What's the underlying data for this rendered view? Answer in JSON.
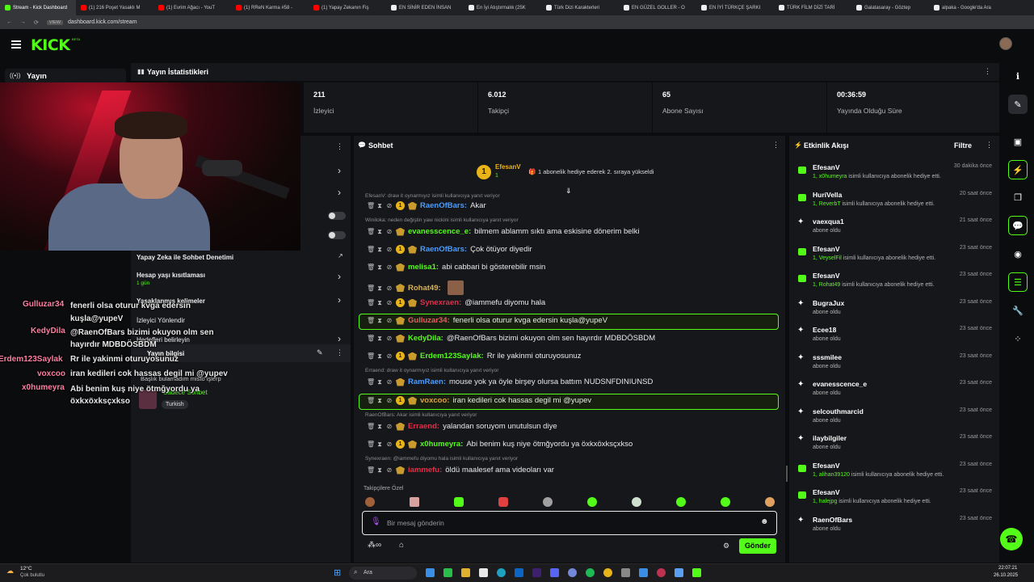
{
  "browser": {
    "tabs": [
      {
        "label": "Stream - Kick Dashboard",
        "active": true
      },
      {
        "label": "(1) 216 Poşet Yasaklı M"
      },
      {
        "label": "(1) Evrim Ağacı - YouT"
      },
      {
        "label": "(1) RReN Karma #58 -"
      },
      {
        "label": "(1) Yapay Zekanın Fiş"
      },
      {
        "label": "EN SİNİR EDEN İNSAN"
      },
      {
        "label": "En İyi Atıştırmalık (25K"
      },
      {
        "label": "Türk Dizi Karakterleri"
      },
      {
        "label": "EN GÜZEL GOLLER - O"
      },
      {
        "label": "EN İYİ TÜRKÇE ŞARKI"
      },
      {
        "label": "TÜRK FİLM DİZİ TARİ"
      },
      {
        "label": "Galatasaray - Göztep"
      },
      {
        "label": "alpaka - Google'da Ara"
      }
    ],
    "url": "dashboard.kick.com/stream",
    "site_badge": "VIEW"
  },
  "header": {
    "logo": "KICK",
    "logo_badge": "BETA"
  },
  "left_nav": {
    "section": "Yayın"
  },
  "stats": {
    "title": "Yayın İstatistikleri",
    "items": [
      {
        "value": "211",
        "label": "İzleyici"
      },
      {
        "value": "6.012",
        "label": "Takipçi"
      },
      {
        "value": "65",
        "label": "Abone Sayısı"
      },
      {
        "value": "00:36:59",
        "label": "Yayında Olduğu Süre"
      }
    ]
  },
  "settings_panel": {
    "ai_moderation": "Yapay Zeka ile Sohbet Denetimi",
    "account_age": "Hesap yaşı kısıtlaması",
    "account_age_value": "1 gün",
    "banned_words": "Yasaklanmış kelimeler",
    "viewer_redirect": "İzleyici Yönlendir",
    "target_label": "Hedefleri belirleyin",
    "stream_info": "Yayın bilgisi",
    "stream_title_partial": "Başlık bulamadım misto işlerp",
    "mode": "Sadece Sohbet",
    "language": "Turkish"
  },
  "overlay_chat": [
    {
      "user": "Gulluzar34",
      "text": "fenerli olsa oturur kvga edersin kuşla@yupeV"
    },
    {
      "user": "KedyDila",
      "text": "@RaenOfBars bizimi okuyon olm sen hayırdır MDBDÖSBDM"
    },
    {
      "user": "Erdem123Saylak",
      "text": "Rr ile yakinmi oturuyosunuz"
    },
    {
      "user": "voxcoo",
      "text": "iran kedileri cok hassas degil mi @yupev"
    },
    {
      "user": "x0humeyra",
      "text": "Abi benim kuş niye ötmğyordu ya öxkxöxksçxkso"
    }
  ],
  "chat": {
    "title": "Sohbet",
    "pinned_user": "EfesanV",
    "pinned_count": "1",
    "pinned_text": "1 abonelik hediye ederek 2. sıraya yükseldi",
    "reply_top": "EfesanV: draw it oynarmıyız isimli kullanıcıya yanıt veriyor",
    "messages": [
      {
        "user": "RaenOfBars",
        "color": "#4a9cff",
        "text": "Akar"
      },
      {
        "reply": "Winiloka: neden değiştin yaw nickini isimli kullanıcıya yanıt veriyor"
      },
      {
        "user": "evanesscence_e",
        "color": "#53fc18",
        "text": "bilmem ablamm sıktı ama eskisine dönerim belki"
      },
      {
        "user": "RaenOfBars",
        "color": "#4a9cff",
        "text": "Çok ötüyor diyedir"
      },
      {
        "user": "melisa1",
        "color": "#53fc18",
        "text": "abi cabbari bi gösterebilir msin"
      },
      {
        "user": "Rohat49",
        "color": "#d6b35a",
        "text": ""
      },
      {
        "user": "Synexraen",
        "color": "#e0304a",
        "text": "@iammefu diyomu hala"
      },
      {
        "user": "Gulluzar34",
        "color": "#e06060",
        "text": "fenerli olsa oturur kvga edersin kuşla@yupeV"
      },
      {
        "user": "KedyDila",
        "color": "#53fc18",
        "text": "@RaenOfBars bizimi okuyon olm sen hayırdır MDBDÖSBDM"
      },
      {
        "user": "Erdem123Saylak",
        "color": "#53fc18",
        "text": "Rr ile yakinmi oturuyosunuz"
      },
      {
        "reply": "Erraend: draw it oynarmıyız isimli kullanıcıya yanıt veriyor"
      },
      {
        "user": "RamRaen",
        "color": "#4a9cff",
        "text": "mouse yok ya öyle birşey olursa battım NUDSNFDINIUNSD"
      },
      {
        "user": "voxcoo",
        "color": "#e0a040",
        "text": "iran kedileri cok hassas degil mi @yupev"
      },
      {
        "reply": "RaenOfBars: Akar isimli kullanıcıya yanıt veriyor"
      },
      {
        "user": "Erraend",
        "color": "#e0304a",
        "text": "yalandan soruyom unutulsun diye"
      },
      {
        "user": "x0humeyra",
        "color": "#53fc18",
        "text": "Abi benim kuş niye ötmğyordu ya öxkxöxksçxkso"
      },
      {
        "reply": "Synexraen: @iammefu diyomu hala isimli kullanıcıya yanıt veriyor"
      },
      {
        "user": "iammefu",
        "color": "#e0304a",
        "text": "öldü maalesef ama videoları var"
      }
    ],
    "emote_section": "Takipçilere Özel",
    "input_placeholder": "Bir mesaj gönderin",
    "send": "Gönder"
  },
  "activity": {
    "title": "Etkinlik Akışı",
    "filter": "Filtre",
    "items": [
      {
        "name": "EfesanV",
        "time": "30 dakika önce",
        "count": "1,",
        "target": "x0humeyra",
        "text": "isimli kullanıcıya abonelik hediye etti.",
        "type": "gift"
      },
      {
        "name": "HuriVella",
        "time": "20 saat önce",
        "count": "1,",
        "target": "ReverbT",
        "text": "isimli kullanıcıya abonelik hediye etti.",
        "type": "gift"
      },
      {
        "name": "vaexqua1",
        "time": "21 saat önce",
        "text": "abone oldu",
        "type": "sub"
      },
      {
        "name": "EfesanV",
        "time": "23 saat önce",
        "count": "1,",
        "target": "VeyselFil",
        "text": "isimli kullanıcıya abonelik hediye etti.",
        "type": "gift"
      },
      {
        "name": "EfesanV",
        "time": "23 saat önce",
        "count": "1,",
        "target": "Rohat49",
        "text": "isimli kullanıcıya abonelik hediye etti.",
        "type": "gift"
      },
      {
        "name": "BugraJux",
        "time": "23 saat önce",
        "text": "abone oldu",
        "type": "sub"
      },
      {
        "name": "Ecee18",
        "time": "23 saat önce",
        "text": "abone oldu",
        "type": "sub"
      },
      {
        "name": "sssmilee",
        "time": "23 saat önce",
        "text": "abone oldu",
        "type": "sub"
      },
      {
        "name": "evanesscence_e",
        "time": "23 saat önce",
        "text": "abone oldu",
        "type": "sub"
      },
      {
        "name": "selcouthmarcid",
        "time": "23 saat önce",
        "text": "abone oldu",
        "type": "sub"
      },
      {
        "name": "ilaybilgiler",
        "time": "23 saat önce",
        "text": "abone oldu",
        "type": "sub"
      },
      {
        "name": "EfesanV",
        "time": "23 saat önce",
        "count": "1,",
        "target": "alihan39120",
        "text": "isimli kullanıcıya abonelik hediye etti.",
        "type": "gift"
      },
      {
        "name": "EfesanV",
        "time": "23 saat önce",
        "count": "1,",
        "target": "halejpg",
        "text": "isimli kullanıcıya abonelik hediye etti.",
        "type": "gift"
      },
      {
        "name": "RaenOfBars",
        "time": "23 saat önce",
        "text": "abone oldu",
        "type": "sub"
      }
    ]
  },
  "taskbar": {
    "weather_temp": "12°C",
    "weather_text": "Çok bulutlu",
    "search": "Ara",
    "time": "22:07:21",
    "date": "26.10.2025"
  },
  "colors": {
    "accent": "#53fc18",
    "panel": "#16171b",
    "bg": "#0b0c0e"
  }
}
